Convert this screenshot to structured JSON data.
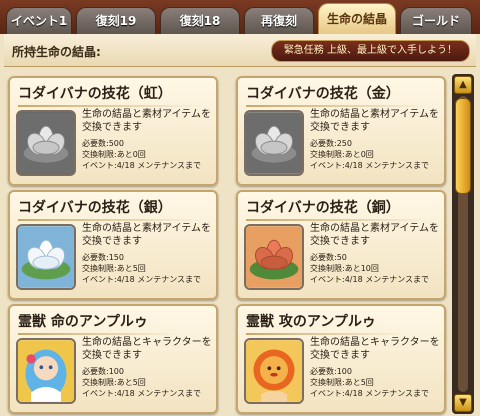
{
  "tabs": [
    {
      "label": "イベント1",
      "active": false
    },
    {
      "label": "復刻19",
      "active": false
    },
    {
      "label": "復刻18",
      "active": false
    },
    {
      "label": "再復刻",
      "active": false
    },
    {
      "label": "生命の結晶",
      "active": true
    },
    {
      "label": "ゴールド",
      "active": false
    }
  ],
  "header": {
    "gem_label": "所持生命の結晶:",
    "notice": "緊急任務 上級、最上級で入手しよう！"
  },
  "items": [
    {
      "title": "コダイバナの技花（虹）",
      "desc": "生命の結晶と素材アイテムを交換できます",
      "cost": "必要数:500",
      "limit": "交換制限:あと0回",
      "period": "イベント:4/18 メンテナンスまで",
      "icon": "lotus-silver-icon"
    },
    {
      "title": "コダイバナの技花（金）",
      "desc": "生命の結晶と素材アイテムを交換できます",
      "cost": "必要数:250",
      "limit": "交換制限:あと0回",
      "period": "イベント:4/18 メンテナンスまで",
      "icon": "lotus-silver-icon"
    },
    {
      "title": "コダイバナの技花（銀）",
      "desc": "生命の結晶と素材アイテムを交換できます",
      "cost": "必要数:150",
      "limit": "交換制限:あと5回",
      "period": "イベント:4/18 メンテナンスまで",
      "icon": "lotus-white-icon"
    },
    {
      "title": "コダイバナの技花（銅）",
      "desc": "生命の結晶と素材アイテムを交換できます",
      "cost": "必要数:50",
      "limit": "交換制限:あと10回",
      "period": "イベント:4/18 メンテナンスまで",
      "icon": "lotus-copper-icon"
    },
    {
      "title": "霊獣 命のアンプルゥ",
      "desc": "生命の結晶とキャラクターを交換できます",
      "cost": "必要数:100",
      "limit": "交換制限:あと5回",
      "period": "イベント:4/18 メンテナンスまで",
      "icon": "spirit-blue-icon"
    },
    {
      "title": "霊獣 攻のアンプルゥ",
      "desc": "生命の結晶とキャラクターを交換できます",
      "cost": "必要数:100",
      "limit": "交換制限:あと5回",
      "period": "イベント:4/18 メンテナンスまで",
      "icon": "spirit-red-icon"
    }
  ],
  "colors": {
    "frame": "#5b2413",
    "panel": "#f2e3c1",
    "card_border": "#c6a56d",
    "active_tab": "#fff3c7",
    "scroll": "#d18d12"
  }
}
